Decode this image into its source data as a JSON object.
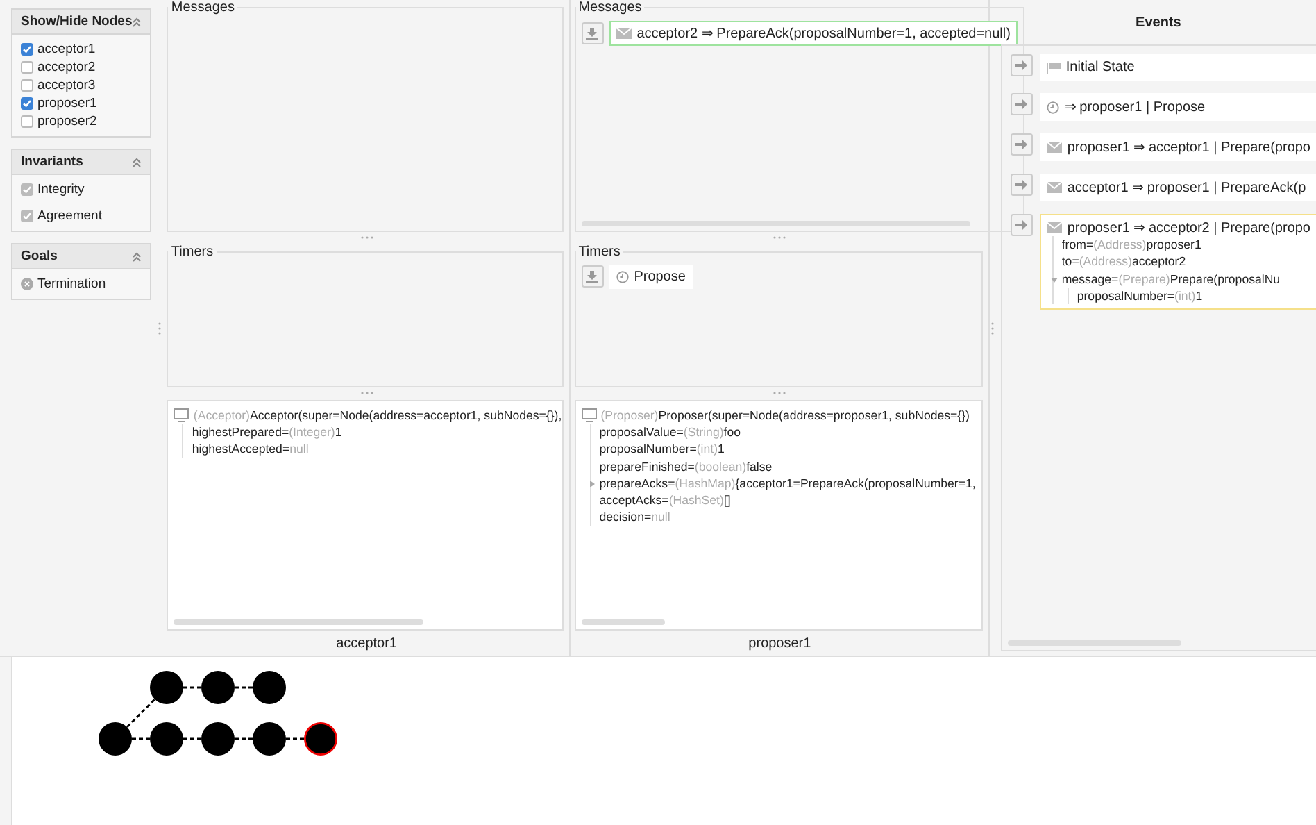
{
  "sidebar": [
    {
      "kind": "nodes",
      "title": "Show/Hide Nodes",
      "expanded": true,
      "items": [
        {
          "label": "acceptor1",
          "checked": true
        },
        {
          "label": "acceptor2",
          "checked": false
        },
        {
          "label": "acceptor3",
          "checked": false
        },
        {
          "label": "proposer1",
          "checked": true
        },
        {
          "label": "proposer2",
          "checked": false
        }
      ]
    },
    {
      "kind": "invariants",
      "title": "Invariants",
      "expanded": true,
      "items": [
        {
          "label": "Integrity",
          "checked": true
        },
        {
          "label": "Agreement",
          "checked": true
        }
      ]
    },
    {
      "kind": "goals",
      "title": "Goals",
      "expanded": true,
      "items": [
        {
          "label": "Termination"
        }
      ]
    }
  ],
  "nodes": [
    {
      "name": "acceptor1",
      "messages_title": "Messages",
      "timers_title": "Timers",
      "state": [
        {
          "type": "(Acceptor)",
          "value": "Acceptor(super=Node(address=acceptor1, subNodes={}),",
          "children": [
            {
              "label": "highestPrepared=",
              "type": "(Integer)",
              "value": "1",
              "muted": false
            },
            {
              "label": "highestAccepted=",
              "value": "null",
              "muted": true
            }
          ]
        }
      ]
    },
    {
      "name": "proposer1",
      "messages_title": "Messages",
      "timers_title": "Timers",
      "messages": [
        {
          "kind": "message",
          "text": "acceptor2 ⇒ PrepareAck(proposalNumber=1, accepted=null)",
          "highlighted": true
        }
      ],
      "timers": [
        {
          "kind": "timer",
          "text": "Propose",
          "highlighted": false
        }
      ],
      "state": [
        {
          "type": "(Proposer)",
          "value": "Proposer(super=Node(address=proposer1, subNodes={})",
          "children": [
            {
              "label": "proposalValue=",
              "type": "(String)",
              "value": "foo",
              "muted": false
            },
            {
              "label": "proposalNumber=",
              "type": "(int)",
              "value": "1",
              "muted": false
            },
            {
              "label": "prepareFinished=",
              "type": "(boolean)",
              "value": "false",
              "muted": false
            },
            {
              "label": "prepareAcks=",
              "type": "(HashMap)",
              "value": "{acceptor1=PrepareAck(proposalNumber=1,",
              "muted": false,
              "expanded": false
            },
            {
              "label": "acceptAcks=",
              "type": "(HashSet)",
              "value": "[]",
              "muted": false
            },
            {
              "label": "decision=",
              "value": "null",
              "muted": true
            }
          ]
        }
      ]
    }
  ],
  "events": {
    "title": "Events",
    "items": [
      {
        "kind": "initial",
        "text": "Initial State",
        "selected": false
      },
      {
        "kind": "timer",
        "text": "⇒ proposer1 | Propose",
        "selected": false
      },
      {
        "kind": "message",
        "text": "proposer1 ⇒ acceptor1 | Prepare(propo",
        "selected": false
      },
      {
        "kind": "message",
        "text": "acceptor1 ⇒ proposer1 | PrepareAck(p",
        "selected": false
      },
      {
        "kind": "message",
        "text": "proposer1 ⇒ acceptor2 | Prepare(propo",
        "selected": true,
        "children": [
          {
            "label": "from=",
            "type": "(Address)",
            "value": "proposer1",
            "muted": false
          },
          {
            "label": "to=",
            "type": "(Address)",
            "value": "acceptor2",
            "muted": false
          },
          {
            "label": "message=",
            "type": "(Prepare)",
            "value": "Prepare(proposalNu",
            "muted": false,
            "expanded": true,
            "children": [
              {
                "label": "proposalNumber=",
                "type": "(int)",
                "value": "1",
                "muted": false
              }
            ]
          }
        ]
      }
    ]
  },
  "state_graph": {
    "root": {
      "current": false,
      "children": [
        {
          "current": false,
          "children": [
            {
              "current": false,
              "children": [
                {
                  "current": false,
                  "children": [
                    {
                      "current": true
                    }
                  ]
                }
              ]
            }
          ]
        },
        {
          "current": false,
          "children": [
            {
              "current": false,
              "children": [
                {
                  "current": false
                }
              ]
            }
          ]
        }
      ]
    }
  }
}
